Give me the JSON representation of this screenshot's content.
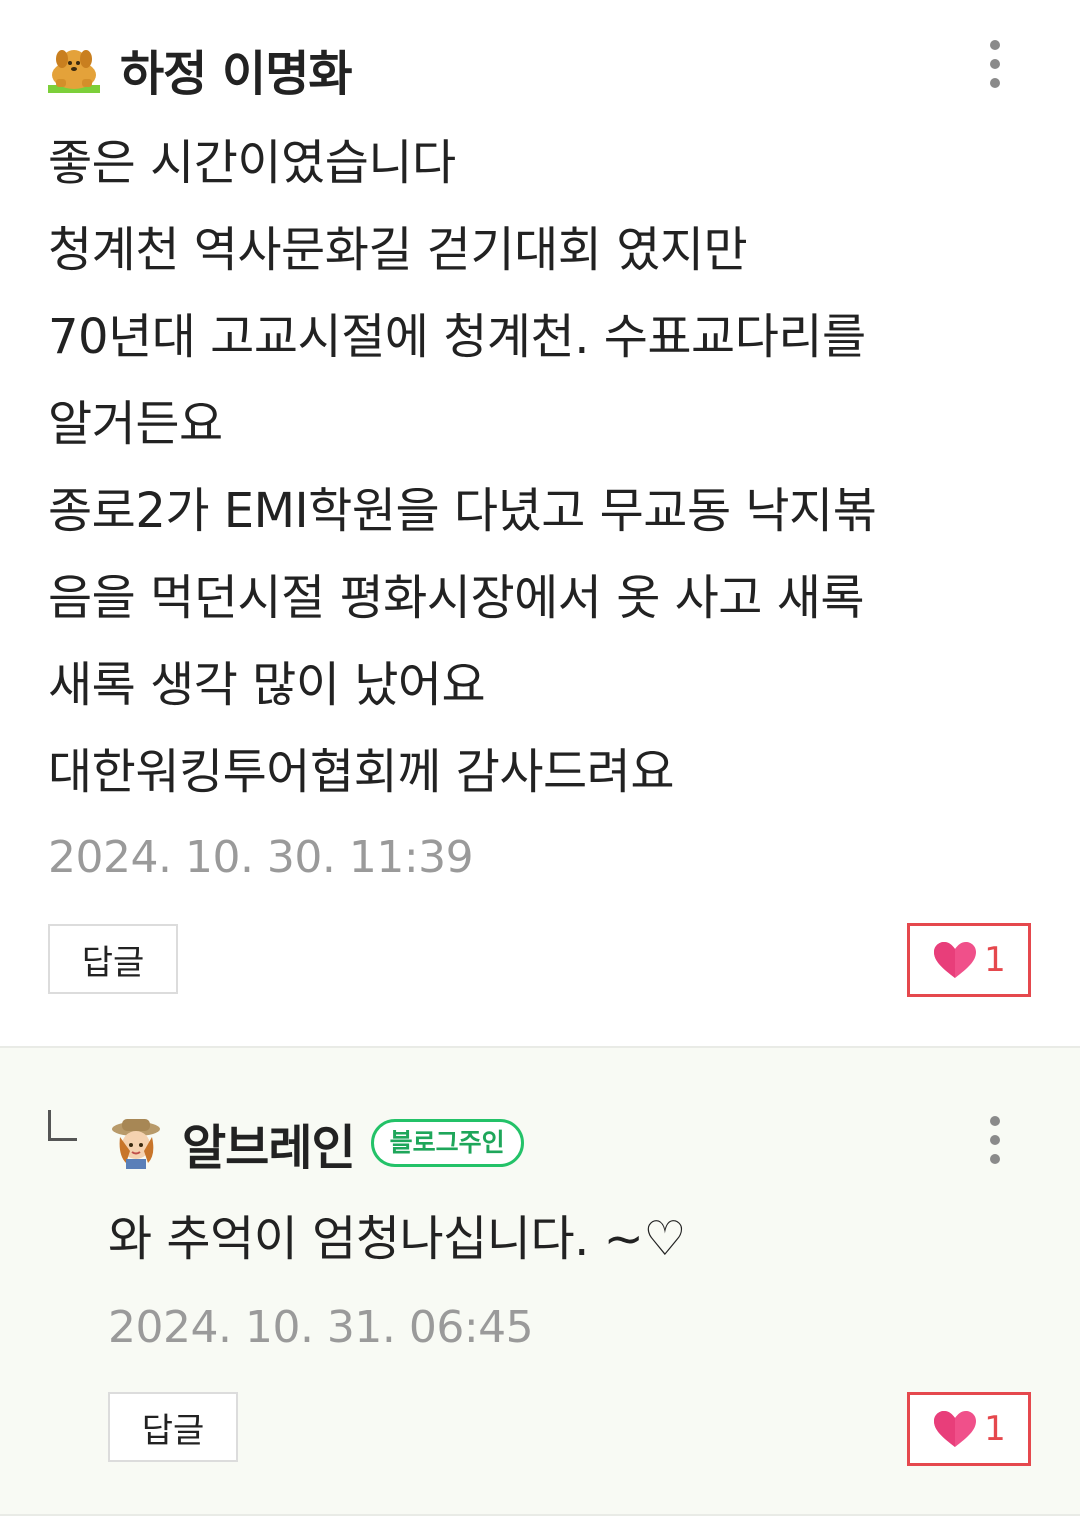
{
  "main_comment": {
    "nickname": "하정 이명화",
    "avatar_icon": "dog-peeking-icon",
    "text_lines": [
      "좋은 시간이였습니다",
      "청계천 역사문화길 걷기대회 였지만",
      "70년대 고교시절에 청계천. 수표교다리를",
      "알거든요",
      "종로2가 EMI학원을 다녔고 무교동 낙지볶",
      "음을 먹던시절 평화시장에서 옷 사고 새록",
      "새록 생각 많이 났어요",
      "대한워킹투어협회께 감사드려요"
    ],
    "timestamp": "2024. 10. 30. 11:39",
    "reply_label": "답글",
    "like_count": "1"
  },
  "reply_comment": {
    "nickname": "알브레인",
    "badge": "블로그주인",
    "avatar_icon": "explorer-hat-avatar-icon",
    "text": "와 추억이 엄청나십니다. ~♡",
    "timestamp": "2024. 10. 31. 06:45",
    "reply_label": "답글",
    "like_count": "1"
  },
  "colors": {
    "like_accent": "#e5484d",
    "badge_green": "#23c268",
    "reply_background": "#f8faf4",
    "timestamp_gray": "#9a9a9a"
  }
}
